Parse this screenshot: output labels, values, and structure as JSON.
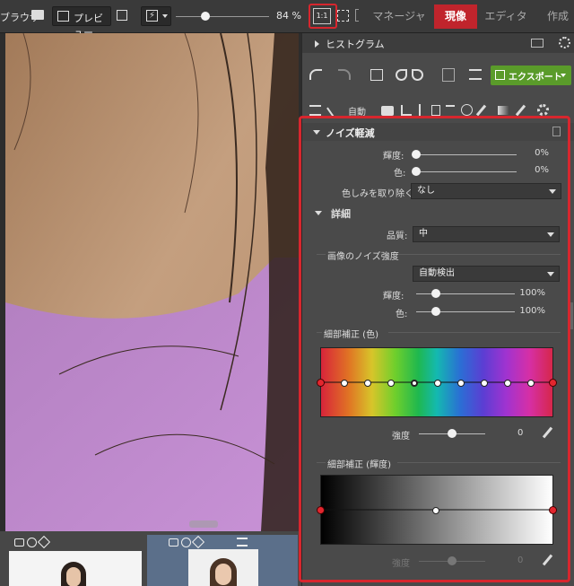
{
  "topbar": {
    "browser_label": "ブラウザ",
    "preview_label": "プレビュー",
    "zoom_value": "84 %",
    "zoom_1to1_label": "1:1",
    "tabs": [
      {
        "label": "マネージャー",
        "active": false
      },
      {
        "label": "現像",
        "active": true
      },
      {
        "label": "エディター",
        "active": false
      },
      {
        "label": "作成",
        "active": false
      }
    ]
  },
  "panel": {
    "histogram_title": "ヒストグラム",
    "export_label": "エクスポート",
    "auto_label": "自動"
  },
  "noise": {
    "title": "ノイズ軽減",
    "luminance_label": "輝度:",
    "luminance_value": "0%",
    "color_label": "色:",
    "color_value": "0%",
    "color_bleed_label": "色しみを取り除く",
    "color_bleed_value": "なし",
    "detail_title": "詳細",
    "quality_label": "品質:",
    "quality_value": "中",
    "strength_group_label": "画像のノイズ強度",
    "strength_mode_value": "自動検出",
    "strength_lum_label": "輝度:",
    "strength_lum_value": "100%",
    "strength_color_label": "色:",
    "strength_color_value": "100%",
    "detail_color_label": "細部補正 (色)",
    "intensity_label": "強度",
    "intensity_value": "0",
    "detail_lum_label": "細部補正 (輝度)",
    "intensity2_label": "強度",
    "intensity2_value": "0"
  },
  "colors": {
    "accent": "#c0242c",
    "export_green": "#5a9b2a",
    "panel_bg": "#4a4a4a"
  }
}
